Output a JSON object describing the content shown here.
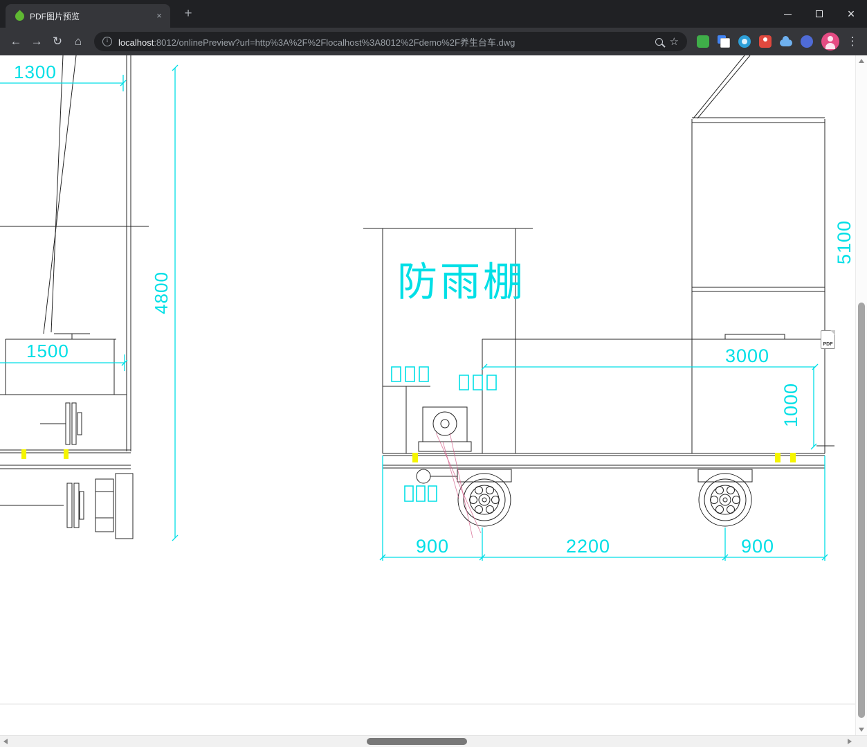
{
  "browser": {
    "tab_title": "PDF图片预览",
    "tab_close": "×",
    "new_tab_label": "+",
    "window_controls": {
      "minimize": "–",
      "close": "×"
    },
    "nav": {
      "back": "←",
      "forward": "→",
      "reload": "↻",
      "home": "⌂"
    },
    "omnibox": {
      "host": "localhost",
      "path": ":8012/onlinePreview?url=http%3A%2F%2Flocalhost%3A8012%2Fdemo%2F养生台车.dwg",
      "bookmark_icon": "☆"
    },
    "menu_icon": "⋮",
    "icons": [
      "spring-leaf-favicon",
      "site-info-icon",
      "zoom-icon",
      "bookmark-star-icon",
      "extension-icons",
      "profile-avatar",
      "more-menu-icon"
    ]
  },
  "viewer": {
    "pdf_badge": "PDF",
    "drawing": {
      "shelter_label": "防雨棚",
      "dims": {
        "top_width": "1300",
        "left_height": "4800",
        "cab_width": "1500",
        "right_height": "5100",
        "deck_length": "3000",
        "deck_height": "1000",
        "left_overhang": "900",
        "wheelbase": "2200",
        "right_overhang": "900"
      }
    }
  },
  "colors": {
    "dimension_cyan": "#00dfe6",
    "line_black": "#242424",
    "highlight_yellow": "#f5f500",
    "construction_magenta": "#d4608a",
    "chrome_frame": "#202124",
    "chrome_toolbar": "#35363a"
  }
}
